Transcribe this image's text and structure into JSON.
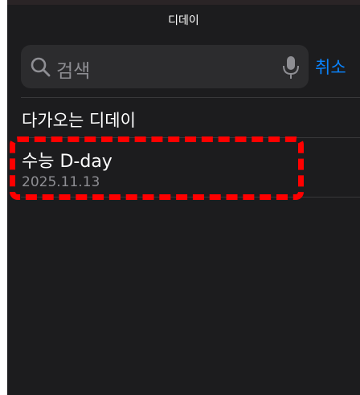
{
  "header": {
    "title": "디데이"
  },
  "search": {
    "placeholder": "검색",
    "cancel_label": "취소"
  },
  "section": {
    "title": "다가오는 디데이"
  },
  "items": [
    {
      "title": "수능 D-day",
      "date": "2025.11.13"
    }
  ],
  "colors": {
    "background": "#1c1c1e",
    "search_field": "#2c2c2e",
    "accent": "#0a84ff",
    "secondary_text": "#8e8e93",
    "highlight_annotation": "#ff0000"
  },
  "icons": {
    "search": "search-icon",
    "mic": "mic-icon"
  }
}
